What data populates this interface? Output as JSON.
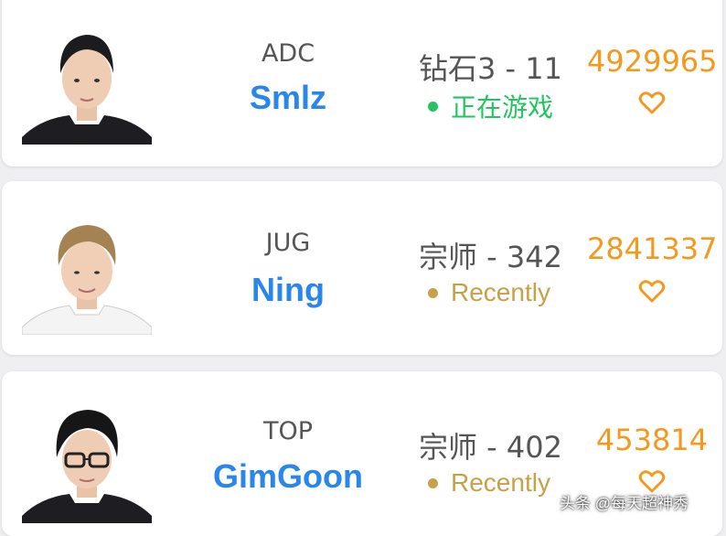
{
  "colors": {
    "name": "#2a86e8",
    "score": "#f39a1e",
    "status_ingame": "#22c55e",
    "status_recent": "#c8a048",
    "text": "#555555"
  },
  "players": [
    {
      "role": "ADC",
      "name": "Smlz",
      "rank": "钻石3 - 11",
      "status": "正在游戏",
      "status_type": "ingame",
      "score": "4929965",
      "icon": "heart-icon"
    },
    {
      "role": "JUG",
      "name": "Ning",
      "rank": "宗师 - 342",
      "status": "Recently",
      "status_type": "recent",
      "score": "2841337",
      "icon": "heart-icon"
    },
    {
      "role": "TOP",
      "name": "GimGoon",
      "rank": "宗师 - 402",
      "status": "Recently",
      "status_type": "recent",
      "score": "453814",
      "icon": "heart-icon"
    }
  ],
  "watermark": "头条 @每天超神秀"
}
